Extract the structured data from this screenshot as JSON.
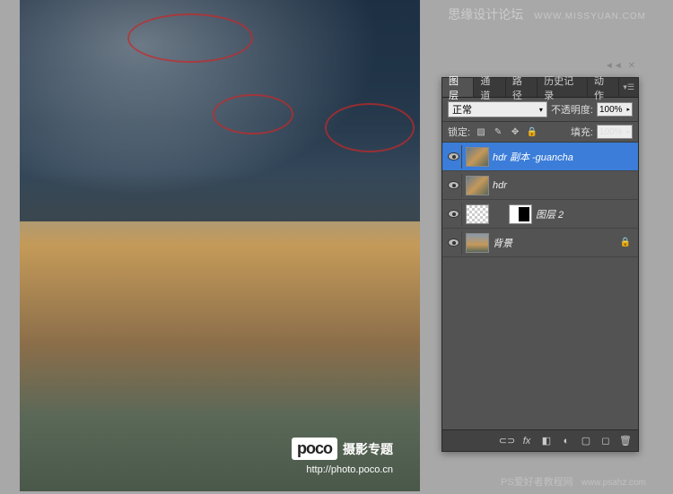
{
  "watermarks": {
    "top_text": "思缘设计论坛",
    "top_url": "WWW.MISSYUAN.COM",
    "bottom_text": "PS爱好者教程网",
    "bottom_url": "www.psahz.com"
  },
  "photo_watermark": {
    "logo": "poco",
    "text": "摄影专题",
    "url": "http://photo.poco.cn"
  },
  "panel": {
    "tabs": [
      {
        "label": "图层",
        "active": true
      },
      {
        "label": "通道",
        "active": false
      },
      {
        "label": "路径",
        "active": false
      },
      {
        "label": "历史记录",
        "active": false
      },
      {
        "label": "动作",
        "active": false
      }
    ],
    "blend_mode": "正常",
    "opacity_label": "不透明度:",
    "opacity_value": "100%",
    "lock_label": "锁定:",
    "fill_label": "填充:",
    "fill_value": "100%",
    "layers": [
      {
        "name": "hdr 副本 -guancha",
        "selected": true,
        "visible": true,
        "thumb": "img",
        "locked": false
      },
      {
        "name": "hdr",
        "selected": false,
        "visible": true,
        "thumb": "img",
        "locked": false
      },
      {
        "name": "图层 2",
        "selected": false,
        "visible": true,
        "thumb": "mask",
        "locked": false,
        "has_mask": true
      },
      {
        "name": "背景",
        "selected": false,
        "visible": true,
        "thumb": "bg",
        "locked": true
      }
    ]
  }
}
